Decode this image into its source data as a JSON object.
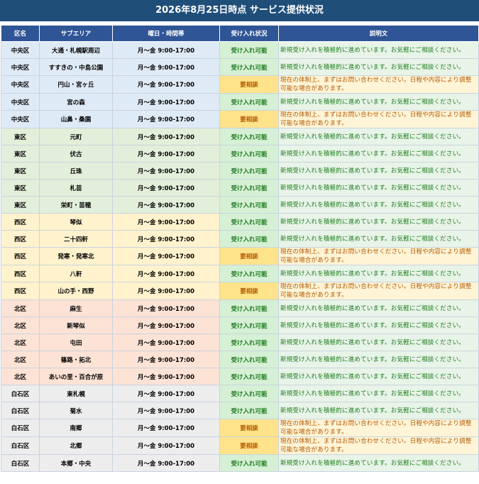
{
  "title": "2026年8月25日時点 サービス提供状況",
  "headers": [
    "区名",
    "サブエリア",
    "曜日・時間帯",
    "受け入れ状況",
    "説明文"
  ],
  "colors": {
    "title_bg": "#1f4e79",
    "header_bg": "#2f5597",
    "status_ok_bg": "#d5f0d5",
    "status_ok_text": "#1e7b1e",
    "status_consult_bg": "#ffe38a",
    "status_consult_text": "#b45a00",
    "group_central": "#deeaf6",
    "group_east": "#e2efda",
    "group_west": "#fff2cc",
    "group_north": "#fde2d6",
    "group_shiroishi": "#ededed"
  },
  "rows": [
    {
      "ward": "中央区",
      "area": "大通・札幌駅周辺",
      "hours": "月〜金 9:00-17:00",
      "status": "受け入れ可能",
      "desc": "新規受け入れを積極的に進めています。お気軽にご相談ください。",
      "group": "central",
      "kind": "ok"
    },
    {
      "ward": "中央区",
      "area": "すすきの・中島公園",
      "hours": "月〜金 9:00-17:00",
      "status": "受け入れ可能",
      "desc": "新規受け入れを積極的に進めています。お気軽にご相談ください。",
      "group": "central",
      "kind": "ok"
    },
    {
      "ward": "中央区",
      "area": "円山・宮ヶ丘",
      "hours": "月〜金 9:00-17:00",
      "status": "要相談",
      "desc": "現在の体制上、まずはお問い合わせください。日程や内容により調整可能な場合があります。",
      "group": "central",
      "kind": "cons"
    },
    {
      "ward": "中央区",
      "area": "宮の森",
      "hours": "月〜金 9:00-17:00",
      "status": "受け入れ可能",
      "desc": "新規受け入れを積極的に進めています。お気軽にご相談ください。",
      "group": "central",
      "kind": "ok"
    },
    {
      "ward": "中央区",
      "area": "山鼻・桑園",
      "hours": "月〜金 9:00-17:00",
      "status": "要相談",
      "desc": "現在の体制上、まずはお問い合わせください。日程や内容により調整可能な場合があります。",
      "group": "central",
      "kind": "cons"
    },
    {
      "ward": "東区",
      "area": "元町",
      "hours": "月〜金 9:00-17:00",
      "status": "受け入れ可能",
      "desc": "新規受け入れを積極的に進めています。お気軽にご相談ください。",
      "group": "east",
      "kind": "ok"
    },
    {
      "ward": "東区",
      "area": "伏古",
      "hours": "月〜金 9:00-17:00",
      "status": "受け入れ可能",
      "desc": "新規受け入れを積極的に進めています。お気軽にご相談ください。",
      "group": "east",
      "kind": "ok"
    },
    {
      "ward": "東区",
      "area": "丘珠",
      "hours": "月〜金 9:00-17:00",
      "status": "受け入れ可能",
      "desc": "新規受け入れを積極的に進めています。お気軽にご相談ください。",
      "group": "east",
      "kind": "ok"
    },
    {
      "ward": "東区",
      "area": "札苗",
      "hours": "月〜金 9:00-17:00",
      "status": "受け入れ可能",
      "desc": "新規受け入れを積極的に進めています。お気軽にご相談ください。",
      "group": "east",
      "kind": "ok"
    },
    {
      "ward": "東区",
      "area": "栄町・苗穂",
      "hours": "月〜金 9:00-17:00",
      "status": "受け入れ可能",
      "desc": "新規受け入れを積極的に進めています。お気軽にご相談ください。",
      "group": "east",
      "kind": "ok"
    },
    {
      "ward": "西区",
      "area": "琴似",
      "hours": "月〜金 9:00-17:00",
      "status": "受け入れ可能",
      "desc": "新規受け入れを積極的に進めています。お気軽にご相談ください。",
      "group": "west",
      "kind": "ok"
    },
    {
      "ward": "西区",
      "area": "二十四軒",
      "hours": "月〜金 9:00-17:00",
      "status": "受け入れ可能",
      "desc": "新規受け入れを積極的に進めています。お気軽にご相談ください。",
      "group": "west",
      "kind": "ok"
    },
    {
      "ward": "西区",
      "area": "発寒・発寒北",
      "hours": "月〜金 9:00-17:00",
      "status": "要相談",
      "desc": "現在の体制上、まずはお問い合わせください。日程や内容により調整可能な場合があります。",
      "group": "west",
      "kind": "cons"
    },
    {
      "ward": "西区",
      "area": "八軒",
      "hours": "月〜金 9:00-17:00",
      "status": "受け入れ可能",
      "desc": "新規受け入れを積極的に進めています。お気軽にご相談ください。",
      "group": "west",
      "kind": "ok"
    },
    {
      "ward": "西区",
      "area": "山の手・西野",
      "hours": "月〜金 9:00-17:00",
      "status": "要相談",
      "desc": "現在の体制上、まずはお問い合わせください。日程や内容により調整可能な場合があります。",
      "group": "west",
      "kind": "cons"
    },
    {
      "ward": "北区",
      "area": "麻生",
      "hours": "月〜金 9:00-17:00",
      "status": "受け入れ可能",
      "desc": "新規受け入れを積極的に進めています。お気軽にご相談ください。",
      "group": "north",
      "kind": "ok"
    },
    {
      "ward": "北区",
      "area": "新琴似",
      "hours": "月〜金 9:00-17:00",
      "status": "受け入れ可能",
      "desc": "新規受け入れを積極的に進めています。お気軽にご相談ください。",
      "group": "north",
      "kind": "ok"
    },
    {
      "ward": "北区",
      "area": "屯田",
      "hours": "月〜金 9:00-17:00",
      "status": "受け入れ可能",
      "desc": "新規受け入れを積極的に進めています。お気軽にご相談ください。",
      "group": "north",
      "kind": "ok"
    },
    {
      "ward": "北区",
      "area": "篠路・拓北",
      "hours": "月〜金 9:00-17:00",
      "status": "受け入れ可能",
      "desc": "新規受け入れを積極的に進めています。お気軽にご相談ください。",
      "group": "north",
      "kind": "ok"
    },
    {
      "ward": "北区",
      "area": "あいの里・百合が原",
      "hours": "月〜金 9:00-17:00",
      "status": "受け入れ可能",
      "desc": "新規受け入れを積極的に進めています。お気軽にご相談ください。",
      "group": "north",
      "kind": "ok"
    },
    {
      "ward": "白石区",
      "area": "東札幌",
      "hours": "月〜金 9:00-17:00",
      "status": "受け入れ可能",
      "desc": "新規受け入れを積極的に進めています。お気軽にご相談ください。",
      "group": "shiroishi",
      "kind": "ok"
    },
    {
      "ward": "白石区",
      "area": "菊水",
      "hours": "月〜金 9:00-17:00",
      "status": "受け入れ可能",
      "desc": "新規受け入れを積極的に進めています。お気軽にご相談ください。",
      "group": "shiroishi",
      "kind": "ok"
    },
    {
      "ward": "白石区",
      "area": "南郷",
      "hours": "月〜金 9:00-17:00",
      "status": "要相談",
      "desc": "現在の体制上、まずはお問い合わせください。日程や内容により調整可能な場合があります。",
      "group": "shiroishi",
      "kind": "cons"
    },
    {
      "ward": "白石区",
      "area": "北郷",
      "hours": "月〜金 9:00-17:00",
      "status": "要相談",
      "desc": "現在の体制上、まずはお問い合わせください。日程や内容により調整可能な場合があります。",
      "group": "shiroishi",
      "kind": "cons"
    },
    {
      "ward": "白石区",
      "area": "本郷・中央",
      "hours": "月〜金 9:00-17:00",
      "status": "受け入れ可能",
      "desc": "新規受け入れを積極的に進めています。お気軽にご相談ください。",
      "group": "shiroishi",
      "kind": "ok"
    }
  ]
}
